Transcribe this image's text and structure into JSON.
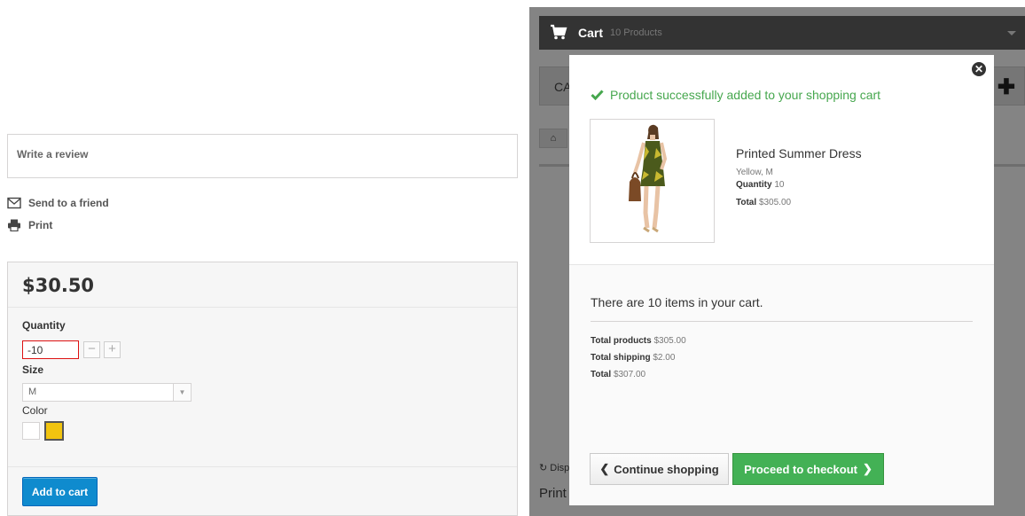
{
  "product": {
    "review_label": "Write a review",
    "send_friend_label": "Send to a friend",
    "print_label": "Print",
    "price": "$30.50",
    "quantity_label": "Quantity",
    "quantity_value": "-10",
    "minus_label": "−",
    "plus_label": "+",
    "size_label": "Size",
    "size_value": "M",
    "color_label": "Color",
    "colors": [
      "#ffffff",
      "#f1c40f"
    ],
    "add_to_cart_label": "Add to cart",
    "accent_color": "#0f8bce"
  },
  "background_page": {
    "cart_label": "Cart",
    "cart_count": "10 Products",
    "category_text": "CA",
    "display_text": "Displ",
    "print_text": "Print"
  },
  "modal": {
    "success_message": "Product successfully added to your shopping cart",
    "product_name": "Printed Summer Dress",
    "product_attributes": "Yellow, M",
    "quantity_label": "Quantity",
    "quantity_value": "10",
    "total_label": "Total",
    "total_value": "$305.00",
    "items_message": "There are 10 items in your cart.",
    "total_products_label": "Total products",
    "total_products_value": "$305.00",
    "total_shipping_label": "Total shipping",
    "total_shipping_value": "$2.00",
    "grand_total_label": "Total",
    "grand_total_value": "$307.00",
    "continue_label": "Continue shopping",
    "checkout_label": "Proceed to checkout",
    "success_color": "#46a74e",
    "checkout_color": "#43b155"
  }
}
